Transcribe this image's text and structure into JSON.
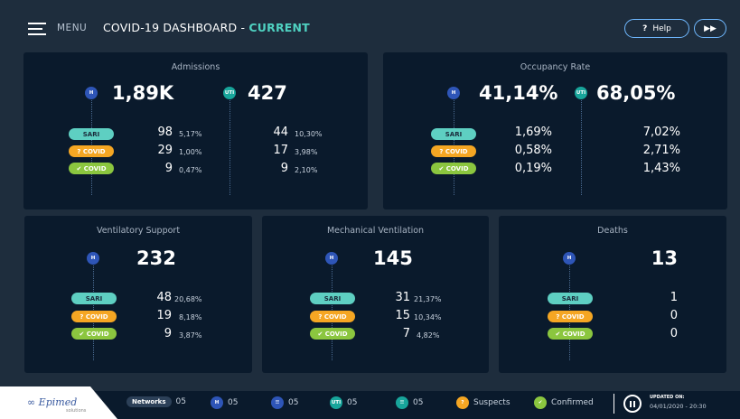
{
  "header": {
    "menu_label": "MENU",
    "title_prefix": "COVID-19 DASHBOARD - ",
    "title_current": "CURRENT",
    "help_label": "Help",
    "help_icon": "?",
    "forward_icon": "▶▶"
  },
  "labels": {
    "sari": "SARI",
    "suspect": "? COVID",
    "confirmed": "✔ COVID",
    "h": "H",
    "uti": "UTI"
  },
  "admissions": {
    "title": "Admissions",
    "h_total": "1,89K",
    "uti_total": "427",
    "h_rows": [
      {
        "value": "98",
        "pct": "5,17%"
      },
      {
        "value": "29",
        "pct": "1,00%"
      },
      {
        "value": "9",
        "pct": "0,47%"
      }
    ],
    "uti_rows": [
      {
        "value": "44",
        "pct": "10,30%"
      },
      {
        "value": "17",
        "pct": "3,98%"
      },
      {
        "value": "9",
        "pct": "2,10%"
      }
    ]
  },
  "occupancy": {
    "title": "Occupancy Rate",
    "h_total": "41,14%",
    "uti_total": "68,05%",
    "h_rows": [
      "1,69%",
      "0,58%",
      "0,19%"
    ],
    "uti_rows": [
      "7,02%",
      "2,71%",
      "1,43%"
    ]
  },
  "ventilatory": {
    "title": "Ventilatory Support",
    "total": "232",
    "rows": [
      {
        "value": "48",
        "pct": "20,68%"
      },
      {
        "value": "19",
        "pct": "8,18%"
      },
      {
        "value": "9",
        "pct": "3,87%"
      }
    ]
  },
  "mechanical": {
    "title": "Mechanical Ventilation",
    "total": "145",
    "rows": [
      {
        "value": "31",
        "pct": "21,37%"
      },
      {
        "value": "15",
        "pct": "10,34%"
      },
      {
        "value": "7",
        "pct": "4,82%"
      }
    ]
  },
  "deaths": {
    "title": "Deaths",
    "total": "13",
    "rows": [
      "1",
      "0",
      "0"
    ]
  },
  "footer": {
    "logo": "Epimed",
    "logo_sub": "solutions",
    "networks_label": "Networks",
    "networks_count": "05",
    "h_count": "05",
    "bed_count": "05",
    "uti_count": "05",
    "uti_bed_count": "05",
    "suspects_label": "Suspects",
    "confirmed_label": "Confirmed",
    "updated_label": "UPDATED ON:",
    "updated_time": "04/01/2020 - 20:30"
  },
  "colors": {
    "background": "#1e2d3d",
    "card": "#0a1a2c",
    "accent_teal": "#4fd1c1",
    "h_blue": "#2e55b7",
    "uti_teal": "#18a59b",
    "sari": "#5ecfc2",
    "suspect": "#f5a623",
    "confirmed": "#8bc63f"
  }
}
